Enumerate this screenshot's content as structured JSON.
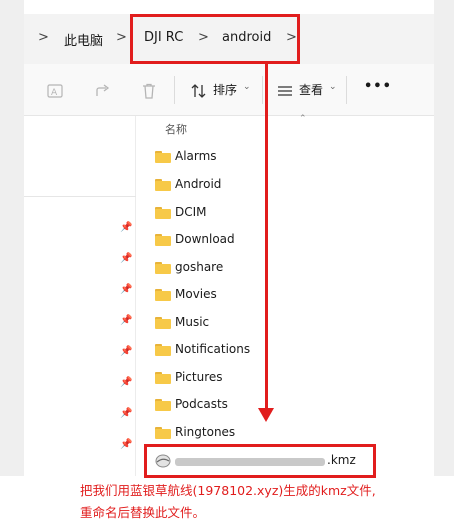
{
  "breadcrumb": {
    "items": [
      "此电脑",
      "DJI RC",
      "android"
    ],
    "separator": ">"
  },
  "toolbar": {
    "sort_label": "排序",
    "view_label": "查看",
    "more_label": "•••"
  },
  "filelist": {
    "column_name": "名称",
    "folders": [
      "Alarms",
      "Android",
      "DCIM",
      "Download",
      "goshare",
      "Movies",
      "Music",
      "Notifications",
      "Pictures",
      "Podcasts",
      "Ringtones"
    ],
    "kmz_extension": ".kmz"
  },
  "caption": {
    "line1": "把我们用蓝银草航线(1978102.xyz)生成的kmz文件,",
    "line2": "重命名后替换此文件。"
  },
  "colors": {
    "highlight": "#e11d1d",
    "folder": "#f7c948"
  }
}
